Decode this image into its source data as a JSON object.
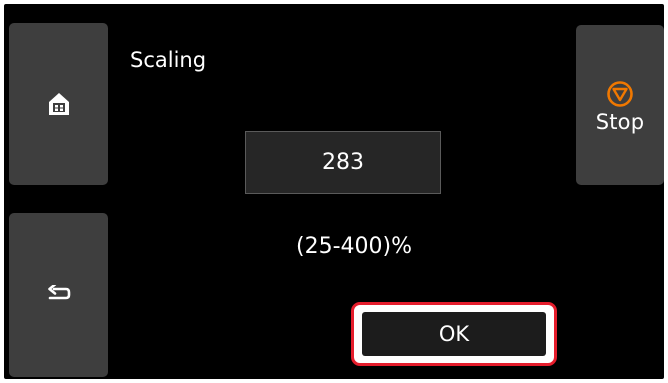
{
  "screen": {
    "title": "Scaling",
    "value": "283",
    "range": "(25-400)%"
  },
  "buttons": {
    "home_icon": "home-icon",
    "back_icon": "back-arrow-icon",
    "stop_icon": "stop-icon",
    "stop_label": "Stop",
    "ok_label": "OK"
  },
  "colors": {
    "background": "#000000",
    "panel_button": "#3e3e3e",
    "stop_accent": "#f07800",
    "highlight": "#e51d2c",
    "text": "#ffffff"
  }
}
